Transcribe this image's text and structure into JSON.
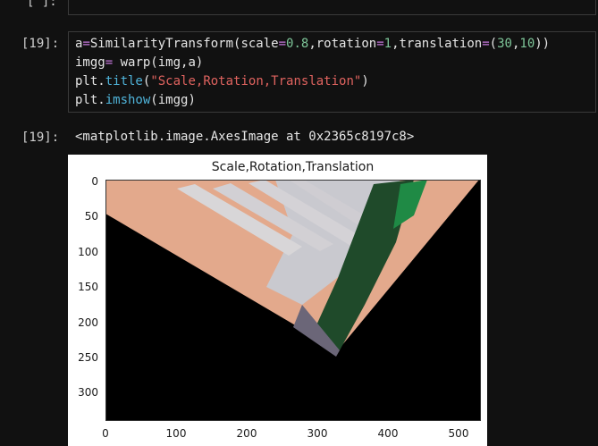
{
  "prev_cell": {
    "prompt": "[ ]:"
  },
  "cell": {
    "prompt": "[19]:",
    "code": {
      "line1": {
        "t1": "a",
        "t2": "=",
        "t3": "SimilarityTransform(scale",
        "t4": "=",
        "t5": "0.8",
        "t6": ",rotation",
        "t7": "=",
        "t8": "1",
        "t9": ",translation",
        "t10": "=",
        "t11": "(",
        "t12": "30",
        "t13": ",",
        "t14": "10",
        "t15": "))"
      },
      "line2": {
        "t1": "imgg",
        "t2": "=",
        "t3": " warp(img,a)"
      },
      "line3": {
        "t1": "plt.",
        "t2": "title",
        "t3": "(",
        "t4": "\"Scale,Rotation,Translation\"",
        "t5": ")"
      },
      "line4": {
        "t1": "plt.",
        "t2": "imshow",
        "t3": "(imgg)"
      }
    }
  },
  "output": {
    "prompt": "[19]:",
    "text": "<matplotlib.image.AxesImage at 0x2365c8197c8>"
  },
  "chart_data": {
    "type": "image",
    "title": "Scale,Rotation,Translation",
    "x_ticks": [
      "0",
      "100",
      "200",
      "300",
      "400",
      "500"
    ],
    "y_ticks": [
      "0",
      "50",
      "100",
      "150",
      "200",
      "250",
      "300"
    ],
    "xlim": [
      0,
      530
    ],
    "ylim": [
      340,
      0
    ]
  },
  "colors": {
    "sky": "#e3a98c",
    "background": "#000000",
    "trees": "#1f4a2a",
    "lawn": "#1f8a45"
  }
}
